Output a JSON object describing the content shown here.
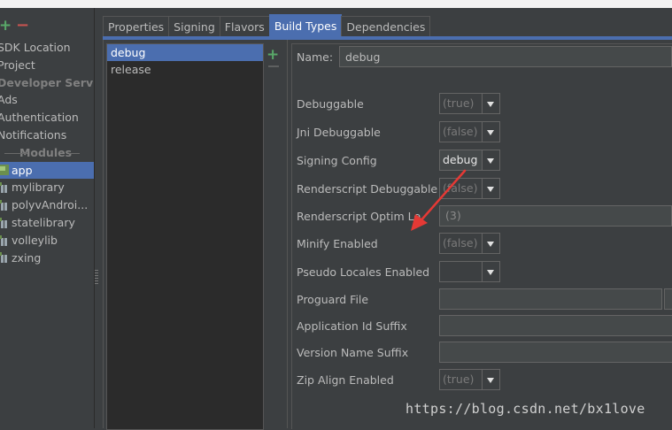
{
  "sidebar": {
    "add_icon": "plus-icon",
    "remove_icon": "minus-icon",
    "items": [
      {
        "label": "SDK Location",
        "kind": "item"
      },
      {
        "label": "Project",
        "kind": "item"
      },
      {
        "label": "Developer Servi...",
        "kind": "header"
      },
      {
        "label": "Ads",
        "kind": "item"
      },
      {
        "label": "Authentication",
        "kind": "item"
      },
      {
        "label": "Notifications",
        "kind": "item"
      }
    ],
    "modules_label": "Modules",
    "modules": [
      {
        "label": "app",
        "icon": "app-module-icon",
        "selected": true
      },
      {
        "label": "mylibrary",
        "icon": "library-module-icon"
      },
      {
        "label": "polyvAndroi...",
        "icon": "library-module-icon"
      },
      {
        "label": "statelibrary",
        "icon": "library-module-icon"
      },
      {
        "label": "volleylib",
        "icon": "library-module-icon"
      },
      {
        "label": "zxing",
        "icon": "library-module-icon"
      }
    ]
  },
  "tabs": [
    "Properties",
    "Signing",
    "Flavors",
    "Build Types",
    "Dependencies"
  ],
  "active_tab": "Build Types",
  "build_types": [
    "debug",
    "release"
  ],
  "selected_build_type": "debug",
  "form": {
    "name_label": "Name:",
    "name_value": "debug",
    "fields": {
      "debuggable": {
        "label": "Debuggable",
        "value": "(true)"
      },
      "jni_debuggable": {
        "label": "Jni Debuggable",
        "value": "(false)"
      },
      "signing_config": {
        "label": "Signing Config",
        "value": "debug"
      },
      "renderscript_debuggable": {
        "label": "Renderscript Debuggable",
        "value": "(false)"
      },
      "renderscript_optim_level": {
        "label": "Renderscript Optim Level",
        "value": "(3)"
      },
      "minify_enabled": {
        "label": "Minify Enabled",
        "value": "(false)"
      },
      "pseudo_locales_enabled": {
        "label": "Pseudo Locales Enabled",
        "value": ""
      },
      "proguard_file": {
        "label": "Proguard File",
        "value": ""
      },
      "application_id_suffix": {
        "label": "Application Id Suffix",
        "value": ""
      },
      "version_name_suffix": {
        "label": "Version Name Suffix",
        "value": ""
      },
      "zip_align_enabled": {
        "label": "Zip Align Enabled",
        "value": "(true)"
      }
    }
  },
  "watermark": "https://blog.csdn.net/bx1love",
  "colors": {
    "accent": "#4b6eaf",
    "add": "#59a869",
    "remove": "#c75450",
    "annotation_arrow": "#e53935"
  }
}
